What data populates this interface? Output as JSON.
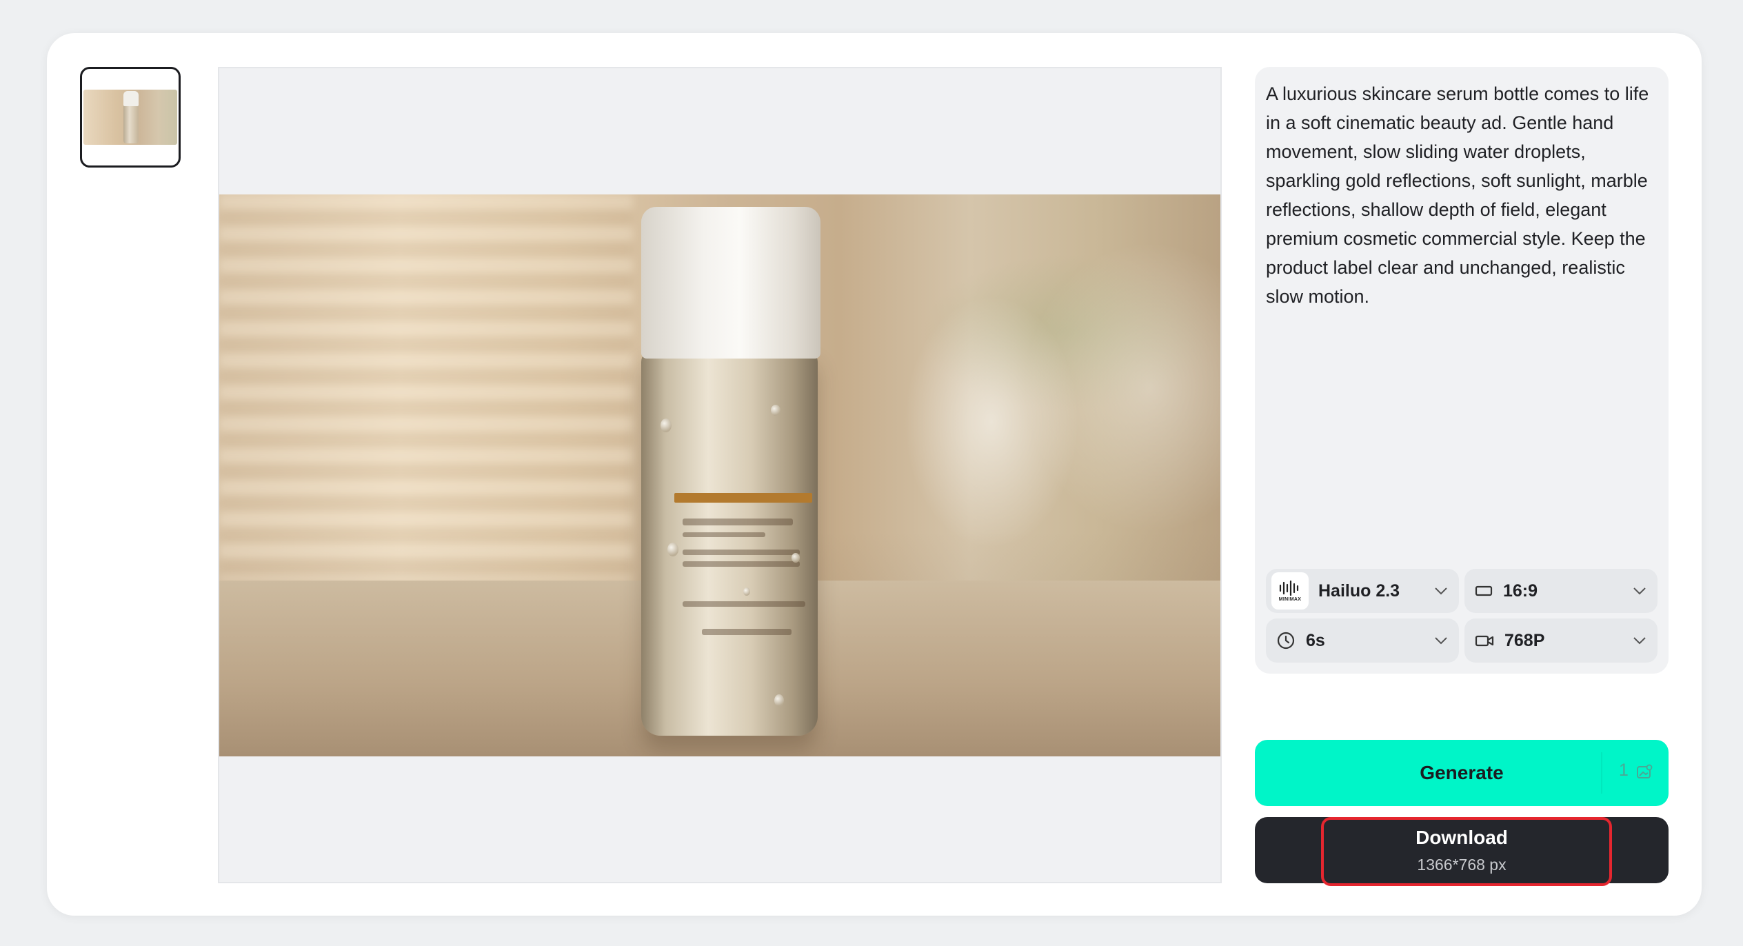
{
  "prompt": {
    "text": "A luxurious skincare serum bottle comes to life in a soft cinematic beauty ad. Gentle hand movement, slow sliding water droplets, sparkling gold reflections, soft sunlight, marble reflections, shallow depth of field, elegant premium cosmetic commercial style. Keep the product label clear and unchanged, realistic slow motion."
  },
  "settings": {
    "model": {
      "label": "Hailuo 2.3",
      "icon": "minimax-logo-icon",
      "logo_text": "MINIMAX"
    },
    "aspect_ratio": {
      "label": "16:9",
      "icon": "aspect-ratio-icon"
    },
    "duration": {
      "label": "6s",
      "icon": "clock-icon"
    },
    "resolution": {
      "label": "768P",
      "icon": "video-camera-icon"
    }
  },
  "generate": {
    "label": "Generate",
    "credits": "1",
    "icon": "credit-image-icon",
    "color": "#00f5c8"
  },
  "download": {
    "label": "Download",
    "size": "1366*768 px",
    "color": "#24262c",
    "highlight_color": "#e5262f"
  }
}
